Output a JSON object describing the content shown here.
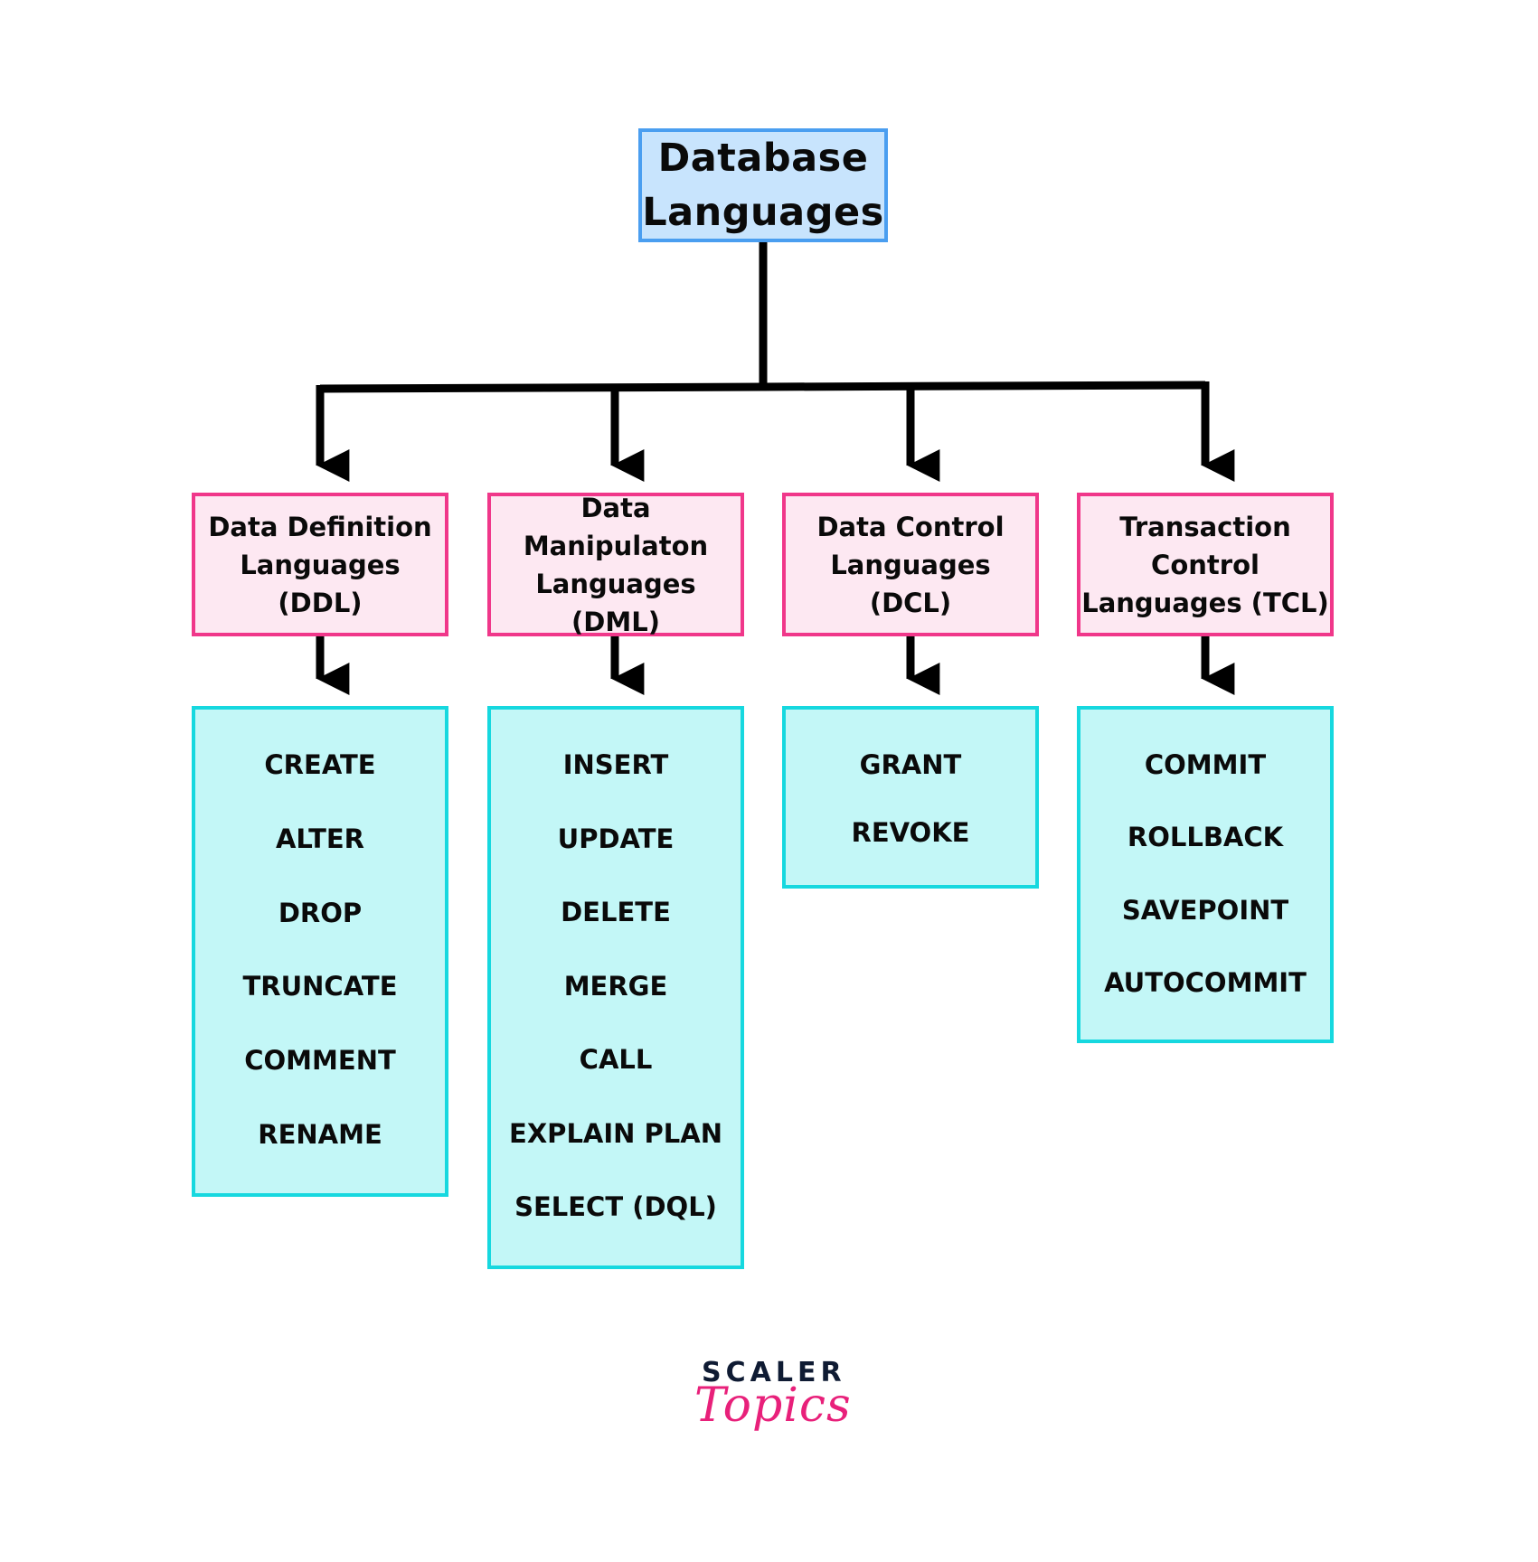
{
  "diagram": {
    "root": {
      "title_line1": "Database",
      "title_line2": "Languages"
    },
    "categories": [
      {
        "lines": [
          "Data Definition",
          "Languages (DDL)"
        ],
        "commands": [
          "CREATE",
          "ALTER",
          "DROP",
          "TRUNCATE",
          "COMMENT",
          "RENAME"
        ]
      },
      {
        "lines": [
          "Data Manipulaton",
          "Languages (DML)"
        ],
        "commands": [
          "INSERT",
          "UPDATE",
          "DELETE",
          "MERGE",
          "CALL",
          "EXPLAIN PLAN",
          "SELECT (DQL)"
        ]
      },
      {
        "lines": [
          "Data Control",
          "Languages (DCL)"
        ],
        "commands": [
          "GRANT",
          "REVOKE"
        ]
      },
      {
        "lines": [
          "Transaction",
          "Control",
          "Languages (TCL)"
        ],
        "commands": [
          "COMMIT",
          "ROLLBACK",
          "SAVEPOINT",
          "AUTOCOMMIT"
        ]
      }
    ],
    "colors": {
      "root_fill": "#c8e4fd",
      "root_border": "#4a9ef0",
      "category_fill": "#fde8f2",
      "category_border": "#f0378a",
      "command_fill": "#c3f7f7",
      "command_border": "#16d8df",
      "connector": "#000000"
    }
  },
  "branding": {
    "logo_top": "SCALER",
    "logo_bottom": "Topics"
  }
}
